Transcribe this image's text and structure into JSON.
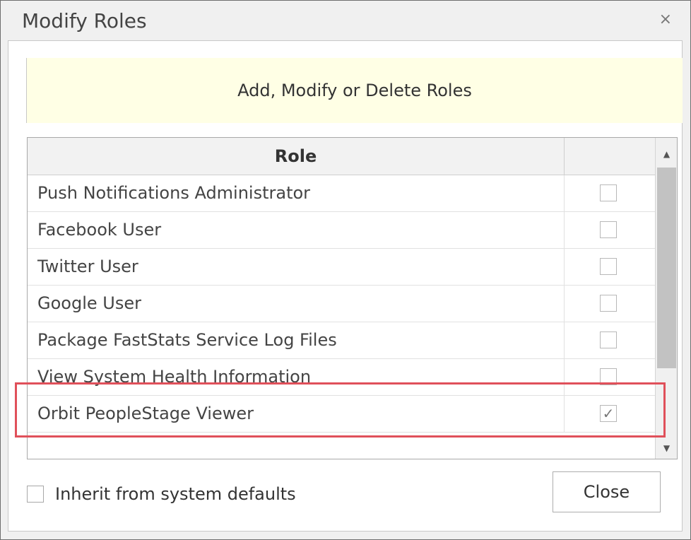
{
  "window": {
    "title": "Modify Roles",
    "close_glyph": "×"
  },
  "banner": {
    "text": "Add, Modify or Delete Roles"
  },
  "table": {
    "header_role": "Role",
    "rows": [
      {
        "label": "Push Notifications Administrator",
        "checked": false
      },
      {
        "label": "Facebook User",
        "checked": false
      },
      {
        "label": "Twitter User",
        "checked": false
      },
      {
        "label": "Google User",
        "checked": false
      },
      {
        "label": "Package FastStats Service Log Files",
        "checked": false
      },
      {
        "label": "View System Health Information",
        "checked": false
      },
      {
        "label": "Orbit PeopleStage Viewer",
        "checked": true
      }
    ],
    "highlighted_row": "Orbit PeopleStage Viewer"
  },
  "footer": {
    "inherit_label": "Inherit from system defaults",
    "inherit_checked": false,
    "close_label": "Close"
  },
  "colors": {
    "banner_bg": "#ffffe5",
    "highlight_border": "#e0505a"
  },
  "icons": {
    "check": "✓",
    "scroll_up": "▲",
    "scroll_down": "▼"
  }
}
